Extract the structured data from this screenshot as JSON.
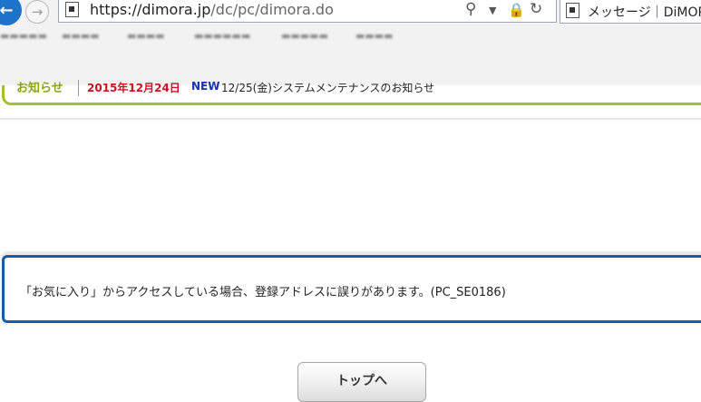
{
  "browser": {
    "url_main": "https://dimora.jp",
    "url_path": "/dc/pc/dimora.do",
    "tab_title": "メッセージ｜DiMORA",
    "nav_back_icon": "back-arrow-icon",
    "nav_forward_icon": "forward-arrow-icon",
    "address_icons": [
      "search-icon",
      "dropdown-icon",
      "lock-icon",
      "refresh-icon"
    ]
  },
  "notice": {
    "label": "お知らせ",
    "date": "2015年12月24日",
    "badge": "NEW",
    "text": "12/25(金)システムメンテナンスのお知らせ",
    "border_color": "#a5c22a"
  },
  "message": {
    "text": "「お気に入り」からアクセスしている場合、登録アドレスに誤りがあります。(PC_SE0186)",
    "border_color": "#1a5aa6"
  },
  "actions": {
    "top_button": "トップへ"
  }
}
